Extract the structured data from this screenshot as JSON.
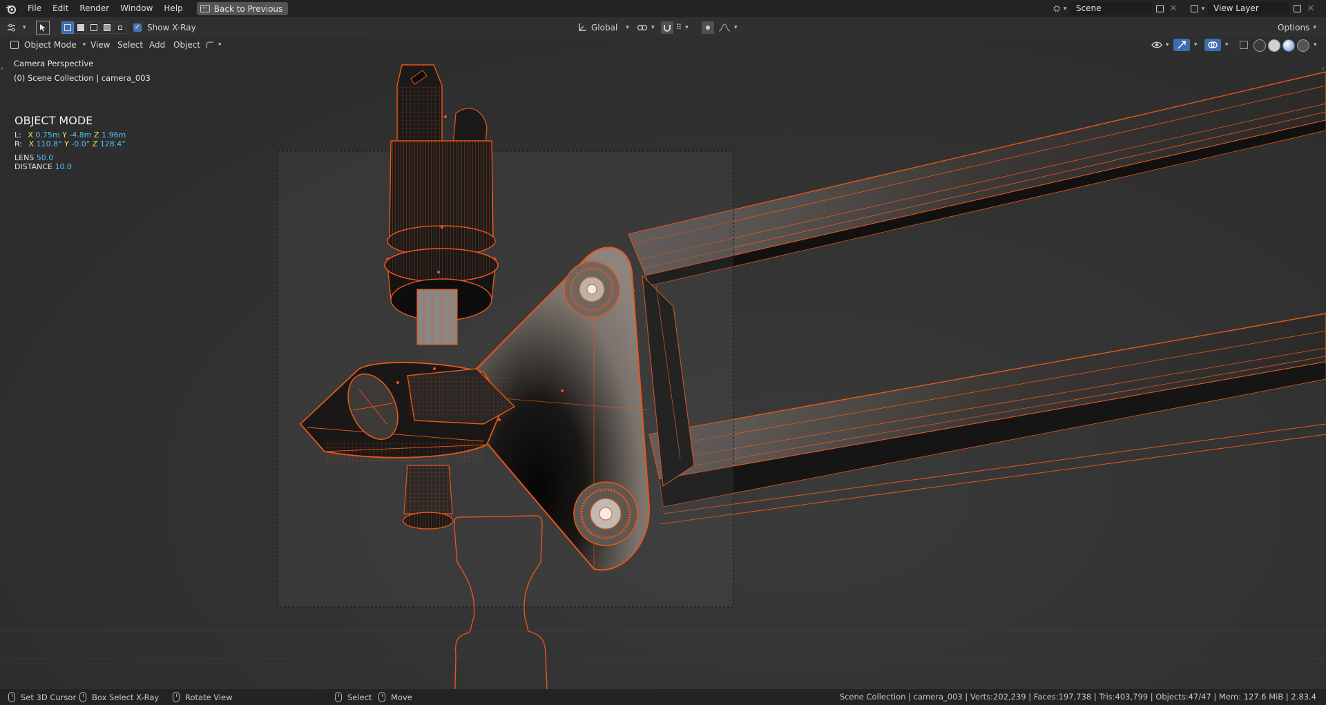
{
  "menu": {
    "items": [
      "File",
      "Edit",
      "Render",
      "Window",
      "Help"
    ],
    "back_button": "Back to Previous"
  },
  "scene": {
    "name": "Scene",
    "view_layer": "View Layer"
  },
  "toolheader": {
    "show_xray_label": "Show X-Ray",
    "transform_orientation": "Global",
    "options_label": "Options"
  },
  "viewheader": {
    "mode": "Object Mode",
    "menus": [
      "View",
      "Select",
      "Add",
      "Object"
    ]
  },
  "viewport": {
    "perspective": "Camera Perspective",
    "collection": "(0) Scene Collection | camera_003",
    "mode_title": "OBJECT MODE",
    "location": {
      "label": "L:",
      "x": "0.75m",
      "y": "-4.8m",
      "z": "1.96m"
    },
    "rotation": {
      "label": "R:",
      "x": "110.8°",
      "y": "-0.0°",
      "z": "128.4°"
    },
    "lens": {
      "label": "LENS",
      "value": "50.0"
    },
    "distance": {
      "label": "DISTANCE",
      "value": "10.0"
    }
  },
  "statusbar": {
    "hints": [
      "Set 3D Cursor",
      "Box Select X-Ray",
      "Rotate View",
      "Select",
      "Move"
    ],
    "stats": "Scene Collection | camera_003 | Verts:202,239 | Faces:197,738 | Tris:403,799 | Objects:47/47 | Mem: 127.6 MiB | 2.83.4"
  },
  "colors": {
    "selection_outline": "#e8561a",
    "xray_accent": "#4772b3",
    "value_text": "#4fc3f7",
    "axis_text": "#f2e25a"
  }
}
